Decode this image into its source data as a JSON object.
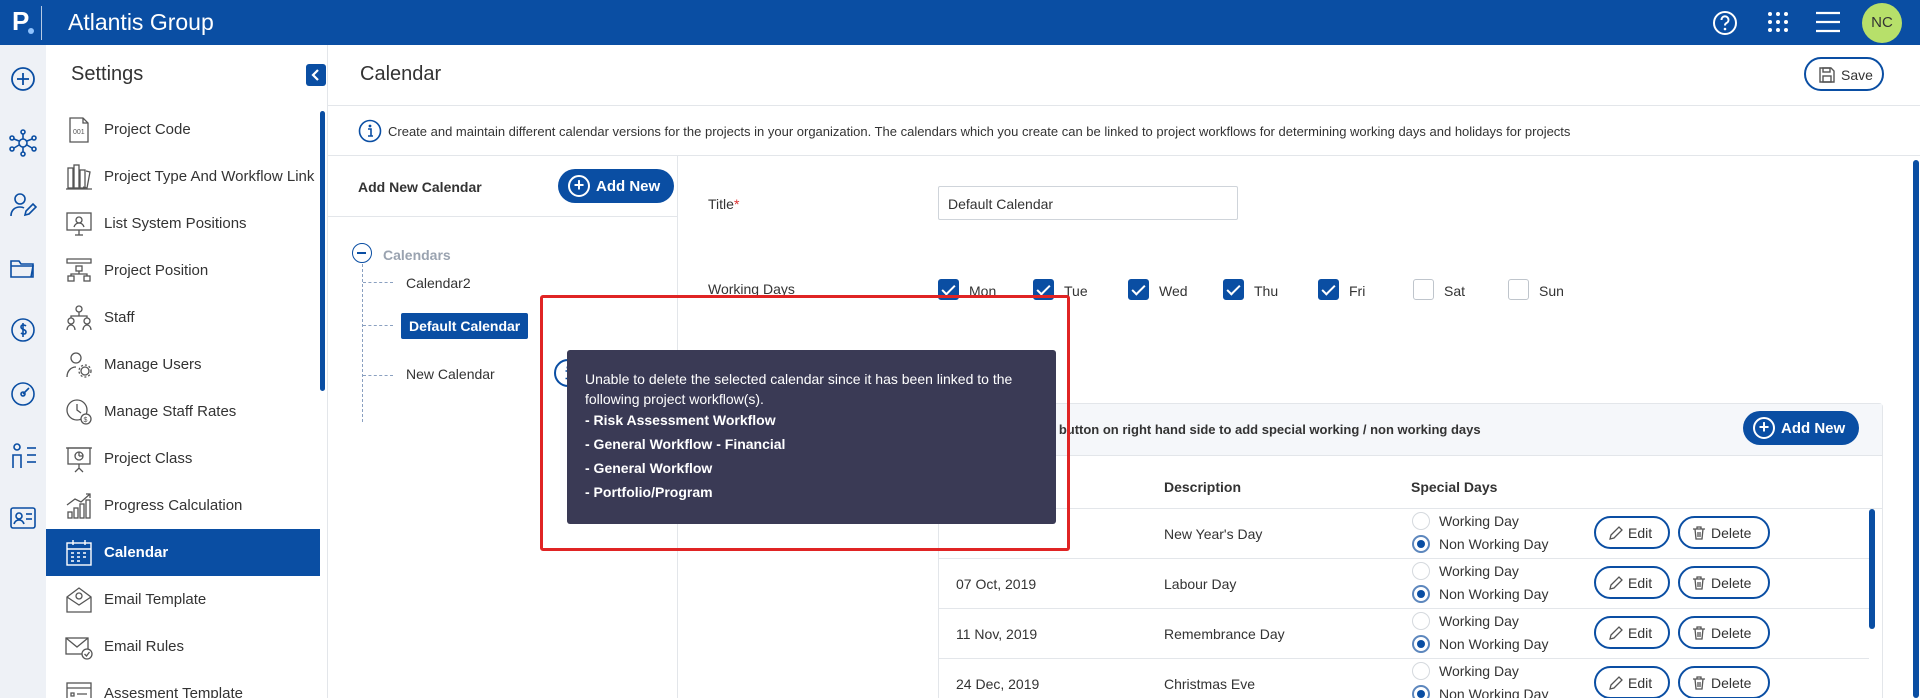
{
  "header": {
    "logo_letter": "P",
    "app_title": "Atlantis Group",
    "avatar_initials": "NC",
    "icons": [
      "help-icon",
      "apps-grid-icon",
      "hamburger-menu-icon"
    ]
  },
  "rail": {
    "icons": [
      "add-circle-icon",
      "network-icon",
      "user-edit-icon",
      "folder-icon",
      "finance-icon",
      "dashboard-gauge-icon",
      "org-chart-icon",
      "contact-card-icon"
    ]
  },
  "settings": {
    "title": "Settings",
    "items": [
      {
        "label": "Project Code",
        "icon": "code-document-icon"
      },
      {
        "label": "Project Type And Workflow Link",
        "icon": "books-icon"
      },
      {
        "label": "List System Positions",
        "icon": "monitor-user-icon"
      },
      {
        "label": "Project Position",
        "icon": "position-chart-icon"
      },
      {
        "label": "Staff",
        "icon": "staff-hierarchy-icon"
      },
      {
        "label": "Manage Users",
        "icon": "user-gear-icon"
      },
      {
        "label": "Manage Staff Rates",
        "icon": "clock-dollar-icon"
      },
      {
        "label": "Project Class",
        "icon": "presentation-icon"
      },
      {
        "label": "Progress Calculation",
        "icon": "progress-bars-icon"
      },
      {
        "label": "Calendar",
        "icon": "calendar-icon"
      },
      {
        "label": "Email Template",
        "icon": "email-template-icon"
      },
      {
        "label": "Email Rules",
        "icon": "email-rules-icon"
      },
      {
        "label": "Assesment Template",
        "icon": "assessment-template-icon"
      }
    ],
    "active_index": 9
  },
  "main": {
    "title": "Calendar",
    "save_label": "Save",
    "info_text": "Create and maintain different calendar versions for the projects in your organization. The calendars which you create can be linked to project workflows for determining working days and holidays for projects"
  },
  "tree": {
    "add_label": "Add New Calendar",
    "add_button": "Add New",
    "root_label": "Calendars",
    "nodes": [
      "Calendar2",
      "Default Calendar",
      "New Calendar"
    ],
    "selected_index": 1
  },
  "detail": {
    "title_label": "Title",
    "required_mark": "*",
    "title_value": "Default Calendar",
    "working_days_label": "Working Days",
    "days": [
      {
        "label": "Mon",
        "checked": true
      },
      {
        "label": "Tue",
        "checked": true
      },
      {
        "label": "Wed",
        "checked": true
      },
      {
        "label": "Thu",
        "checked": true
      },
      {
        "label": "Fri",
        "checked": true
      },
      {
        "label": "Sat",
        "checked": false
      },
      {
        "label": "Sun",
        "checked": false
      }
    ],
    "special_note": "w' button on right hand side to add special working / non working days",
    "special_add_button": "Add New",
    "columns": [
      "Description",
      "Special Days"
    ],
    "radio_options": [
      "Working Day",
      "Non Working Day"
    ],
    "edit_label": "Edit",
    "delete_label": "Delete",
    "rows": [
      {
        "date": "",
        "description": "New Year's Day",
        "selected": "Non Working Day"
      },
      {
        "date": "07 Oct, 2019",
        "description": "Labour Day",
        "selected": "Non Working Day"
      },
      {
        "date": "11 Nov, 2019",
        "description": "Remembrance Day",
        "selected": "Non Working Day"
      },
      {
        "date": "24 Dec, 2019",
        "description": "Christmas Eve",
        "selected": "Non Working Day"
      }
    ]
  },
  "tooltip": {
    "message": "Unable to delete the selected calendar since it has been linked to the following project workflow(s).",
    "workflows": [
      "- Risk Assessment Workflow",
      "- General Workflow - Financial",
      "- General Workflow",
      "- Portfolio/Program"
    ]
  },
  "colors": {
    "brand": "#0a4ea3",
    "tooltip_bg": "#3a3a55",
    "highlight": "#e02424",
    "avatar": "#b7e06a"
  }
}
